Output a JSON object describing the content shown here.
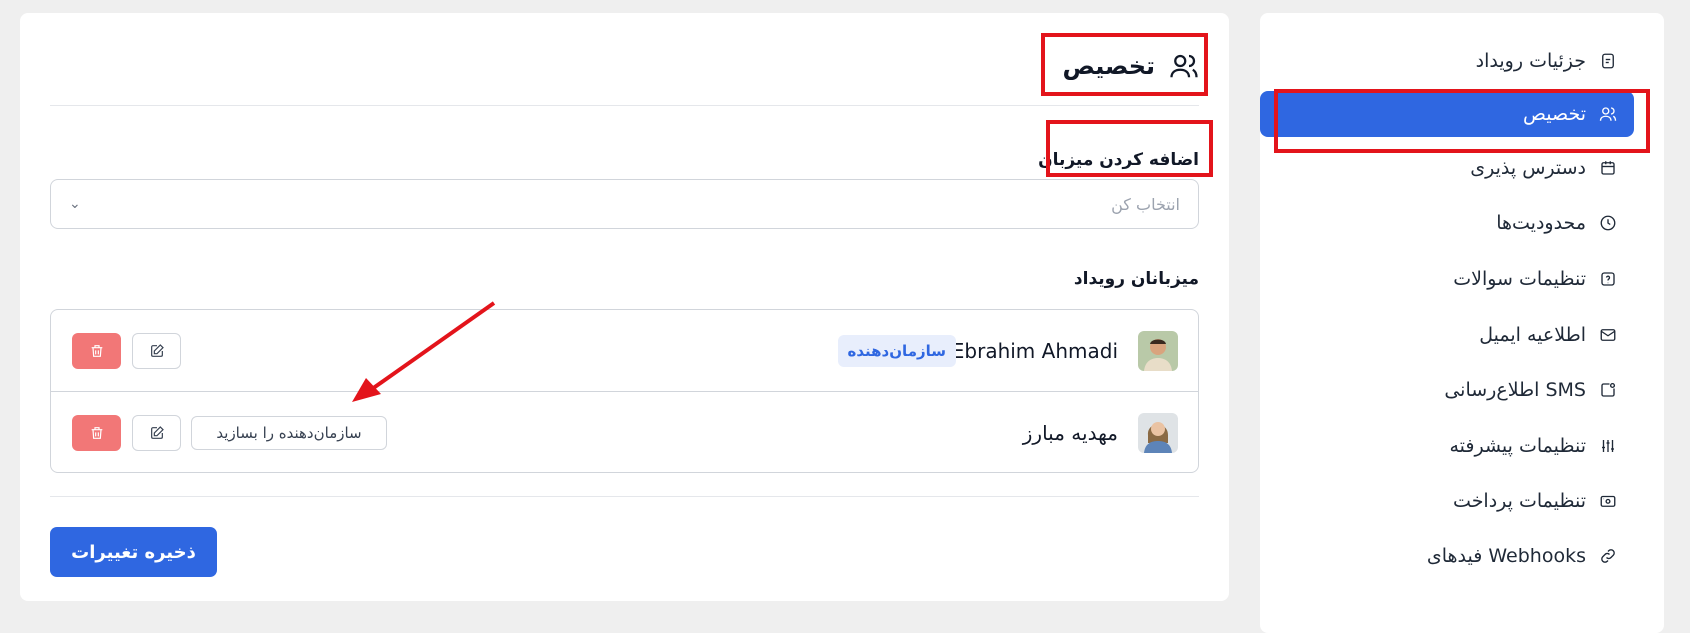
{
  "sidebar": {
    "items": [
      {
        "label": "جزئیات رویداد",
        "icon": "document-icon",
        "active": false
      },
      {
        "label": "تخصیص",
        "icon": "users-icon",
        "active": true
      },
      {
        "label": "دسترس پذیری",
        "icon": "calendar-icon",
        "active": false
      },
      {
        "label": "محدودیت‌ها",
        "icon": "clock-icon",
        "active": false
      },
      {
        "label": "تنظیمات سوالات",
        "icon": "question-icon",
        "active": false
      },
      {
        "label": "اطلاعیه ایمیل",
        "icon": "mail-icon",
        "active": false
      },
      {
        "label": "اطلاع‌رسانی SMS",
        "icon": "sms-icon",
        "active": false
      },
      {
        "label": "تنظیمات پیشرفته",
        "icon": "sliders-icon",
        "active": false
      },
      {
        "label": "تنظیمات پرداخت",
        "icon": "payment-icon",
        "active": false
      },
      {
        "label": "فیدهای Webhooks",
        "icon": "link-icon",
        "active": false
      }
    ]
  },
  "main": {
    "title": "تخصیص",
    "add_host_label": "اضافه کردن میزبان",
    "select_placeholder": "انتخاب کن",
    "hosts_label": "میزبانان رویداد",
    "hosts": [
      {
        "name": "Ebrahim Ahmadi",
        "badge": "سازمان‌دهنده"
      },
      {
        "name": "مهدیه مبارز",
        "action": "سازمان‌دهنده را بسازید"
      }
    ],
    "save_label": "ذخیره تغییرات"
  },
  "colors": {
    "accent": "#2f67e1",
    "danger": "#f27777",
    "annotation": "#e3141b"
  }
}
